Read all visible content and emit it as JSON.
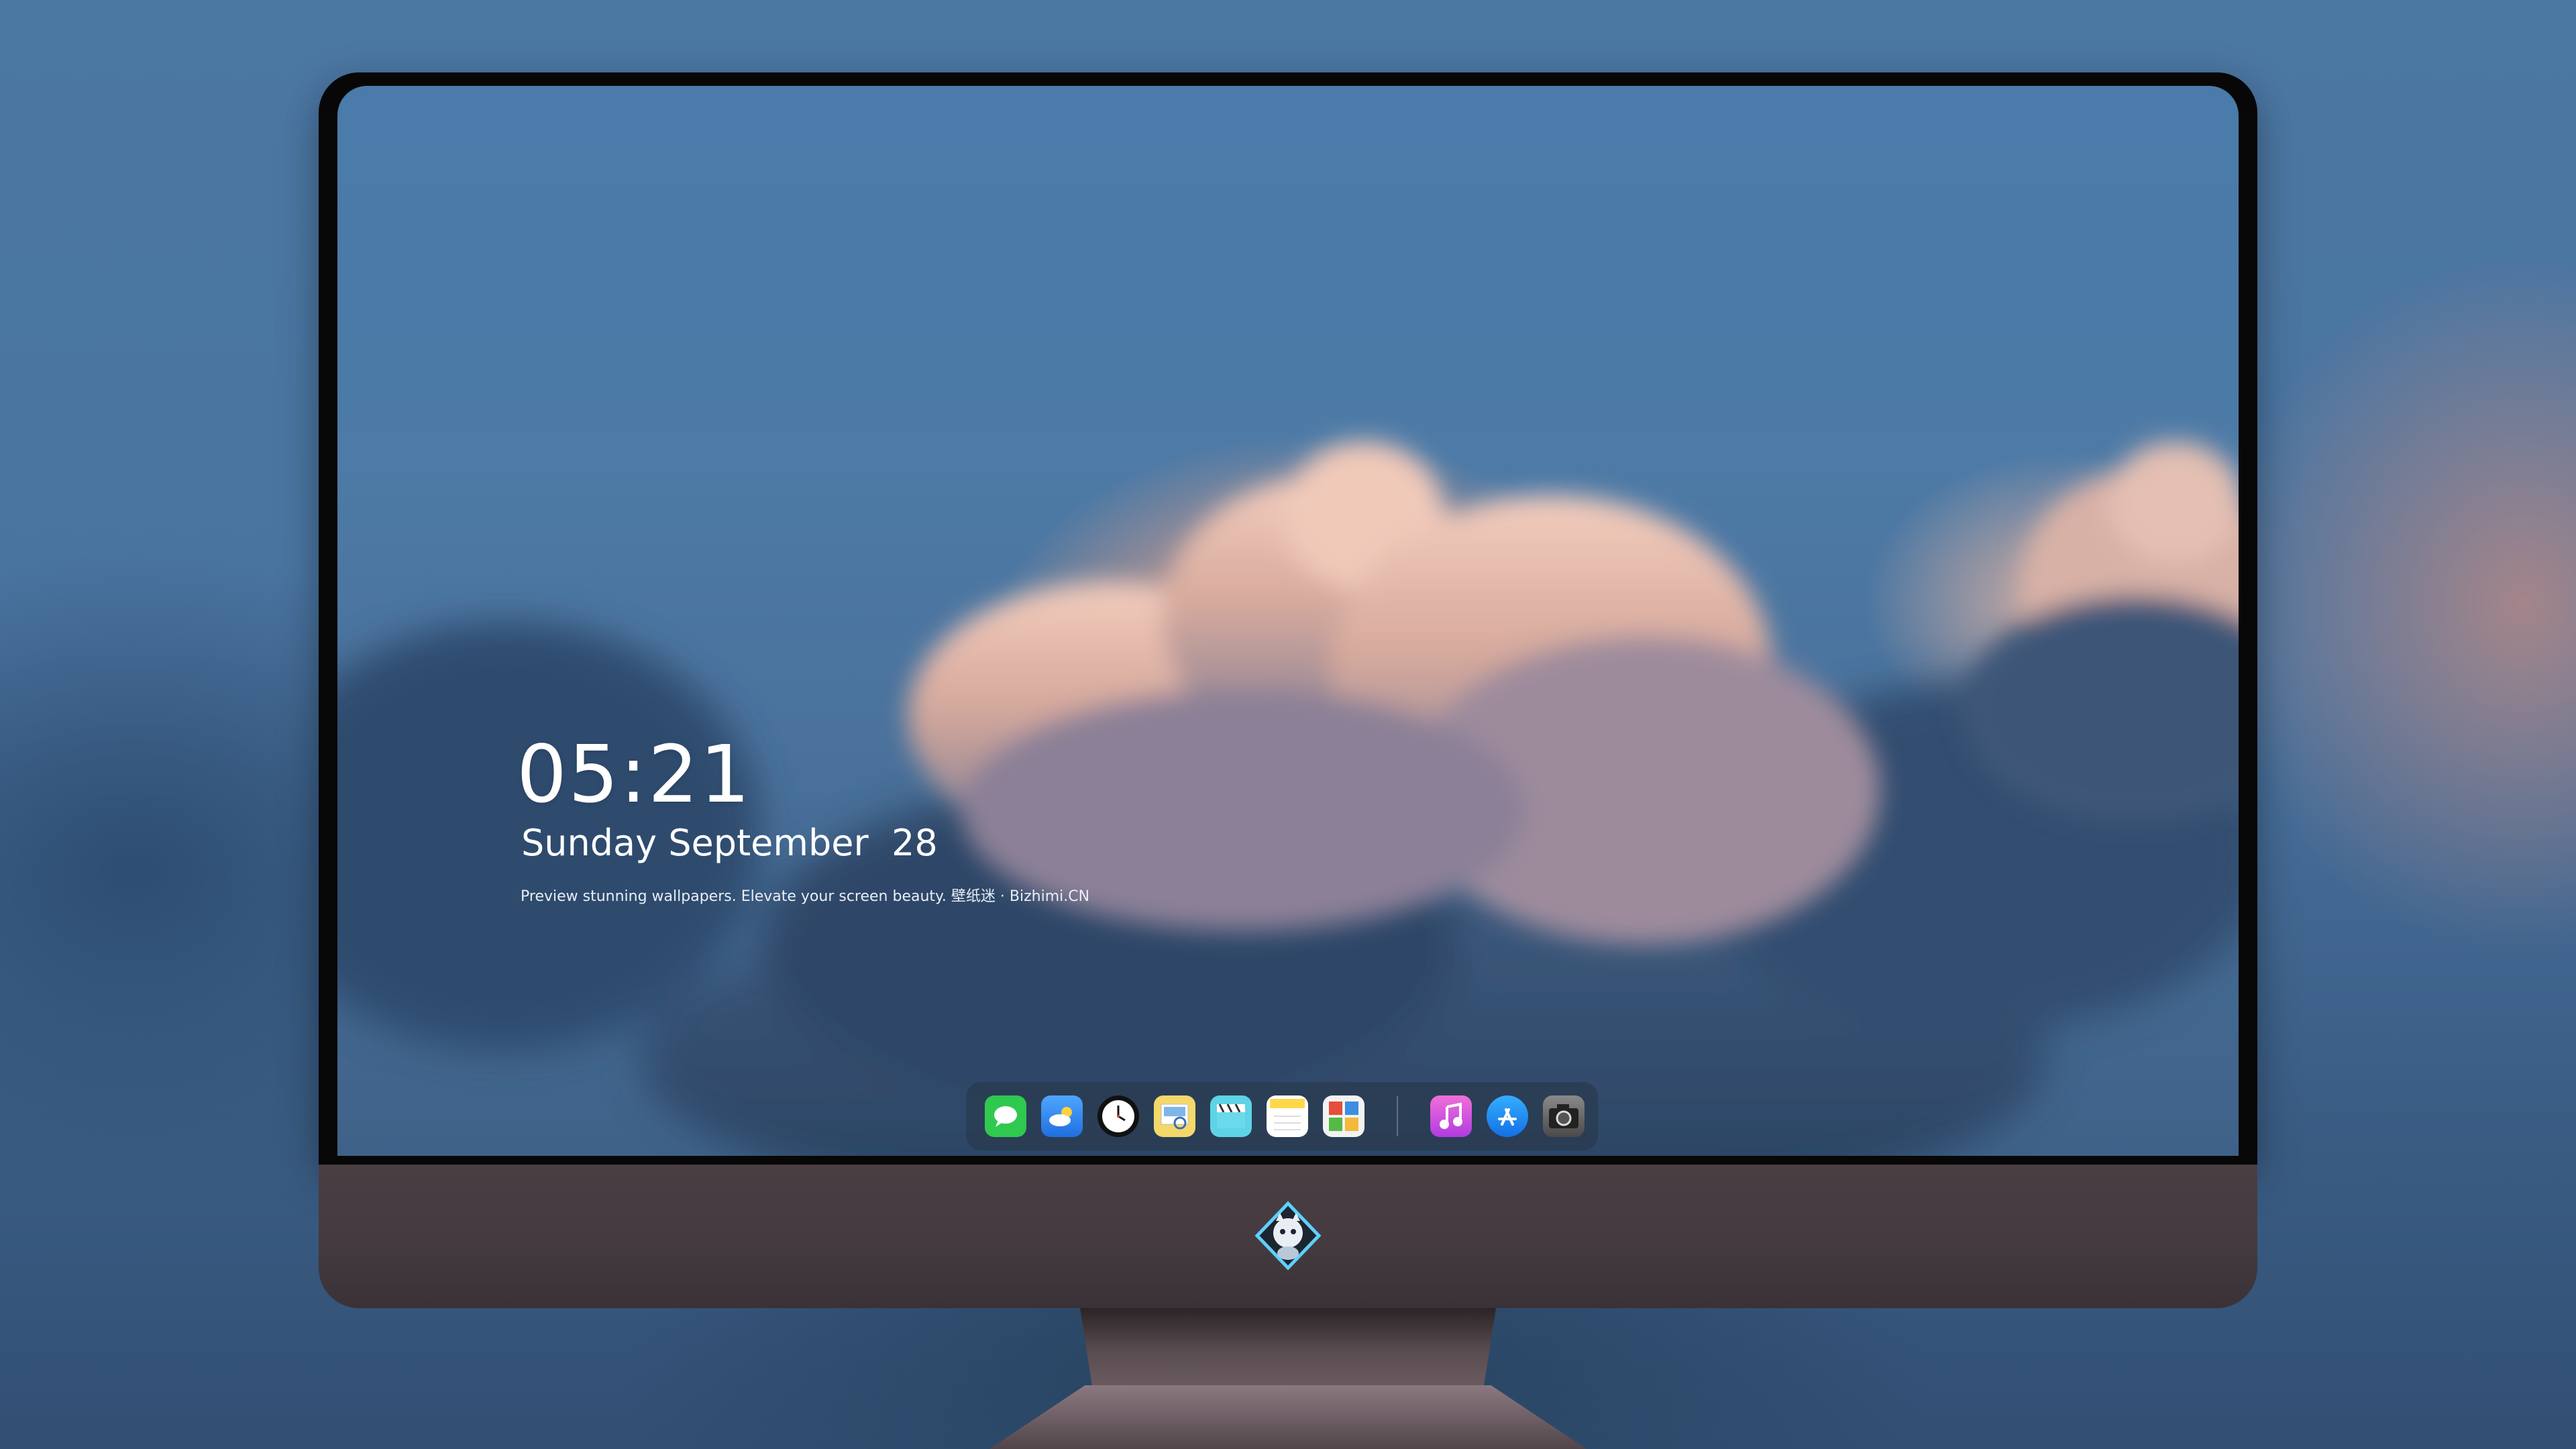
{
  "lockscreen": {
    "time": "05:21",
    "date": "Sunday September  28",
    "tagline": "Preview stunning wallpapers. Elevate your screen beauty. 壁纸迷 · Bizhimi.CN"
  },
  "dock": {
    "apps": [
      {
        "icon": "messages-icon",
        "color": "#2fc94f"
      },
      {
        "icon": "weather-icon",
        "color": "#3a8ef0"
      },
      {
        "icon": "clock-icon",
        "color": "#111111"
      },
      {
        "icon": "preview-icon",
        "color": "#e7c75a"
      },
      {
        "icon": "clips-icon",
        "color": "#5fd3e6"
      },
      {
        "icon": "notes-icon",
        "color": "#ffd84a"
      },
      {
        "icon": "photo-booth-icon",
        "color": "#f2f2f2"
      },
      {
        "icon": "itunes-icon",
        "color": "#d64fe0"
      },
      {
        "icon": "app-store-icon",
        "color": "#1b8cf2"
      },
      {
        "icon": "camera-icon",
        "color": "#6b6b6b"
      }
    ]
  },
  "monitor": {
    "logo_icon": "mascot-logo-icon",
    "bezel_color": "#070707",
    "chin_color": "#433a3f"
  }
}
